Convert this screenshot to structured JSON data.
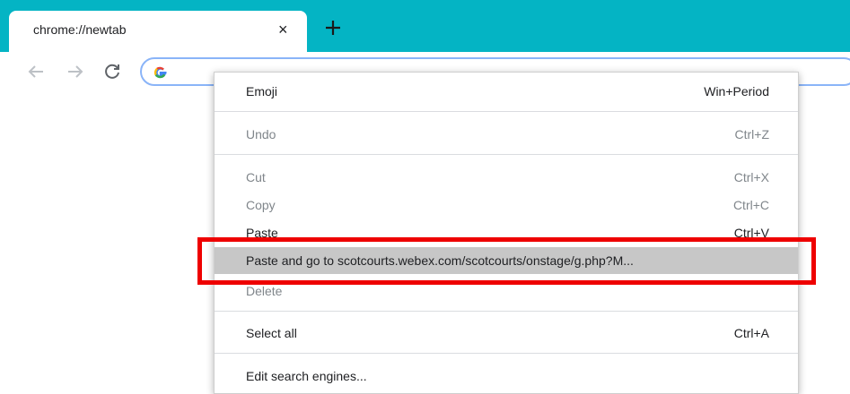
{
  "tab": {
    "title": "chrome://newtab",
    "close_glyph": "×"
  },
  "toolbar": {
    "omnibox_value": ""
  },
  "context_menu": {
    "items": [
      {
        "label": "Emoji",
        "shortcut": "Win+Period"
      },
      {
        "label": "Undo",
        "shortcut": "Ctrl+Z"
      },
      {
        "label": "Cut",
        "shortcut": "Ctrl+X"
      },
      {
        "label": "Copy",
        "shortcut": "Ctrl+C"
      },
      {
        "label": "Paste",
        "shortcut": "Ctrl+V"
      },
      {
        "label": "Paste and go to scotcourts.webex.com/scotcourts/onstage/g.php?M...",
        "shortcut": ""
      },
      {
        "label": "Delete",
        "shortcut": ""
      },
      {
        "label": "Select all",
        "shortcut": "Ctrl+A"
      },
      {
        "label": "Edit search engines...",
        "shortcut": ""
      }
    ]
  },
  "colors": {
    "tabstrip": "#04b4c4",
    "highlight": "#c7c7c7",
    "annotation": "#ee0000",
    "focus_ring": "#8ab4f8"
  },
  "icons": [
    "close-icon",
    "plus-icon",
    "back-arrow-icon",
    "forward-arrow-icon",
    "reload-icon",
    "google-logo-icon"
  ]
}
